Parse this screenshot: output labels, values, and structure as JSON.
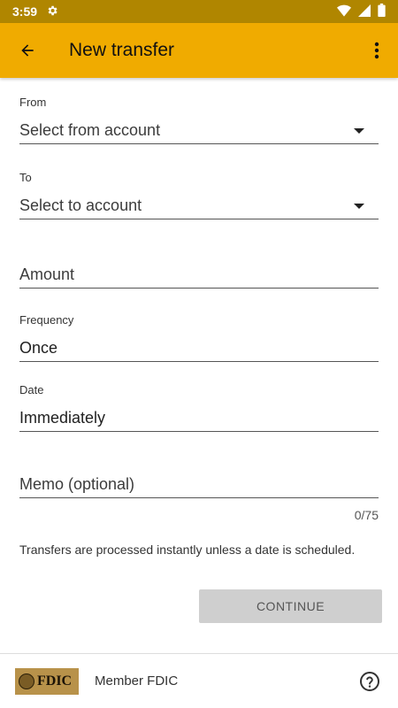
{
  "status_bar": {
    "time": "3:59",
    "icons": [
      "gear-icon",
      "wifi-icon",
      "signal-icon",
      "battery-icon"
    ]
  },
  "app_bar": {
    "title": "New transfer",
    "back_icon": "arrow-back-icon",
    "menu_icon": "more-vertical-icon",
    "background_color": "#f0ab00"
  },
  "form": {
    "from": {
      "label": "From",
      "placeholder": "Select from account"
    },
    "to": {
      "label": "To",
      "placeholder": "Select to account"
    },
    "amount": {
      "placeholder": "Amount"
    },
    "frequency": {
      "label": "Frequency",
      "value": "Once"
    },
    "date": {
      "label": "Date",
      "value": "Immediately"
    },
    "memo": {
      "placeholder": "Memo (optional)",
      "counter": "0/75"
    }
  },
  "notice": "Transfers are processed instantly unless a date is scheduled.",
  "continue_button": {
    "label": "CONTINUE",
    "enabled": false
  },
  "footer": {
    "logo_text": "FDIC",
    "text": "Member FDIC",
    "help_icon": "help-circle-icon"
  }
}
